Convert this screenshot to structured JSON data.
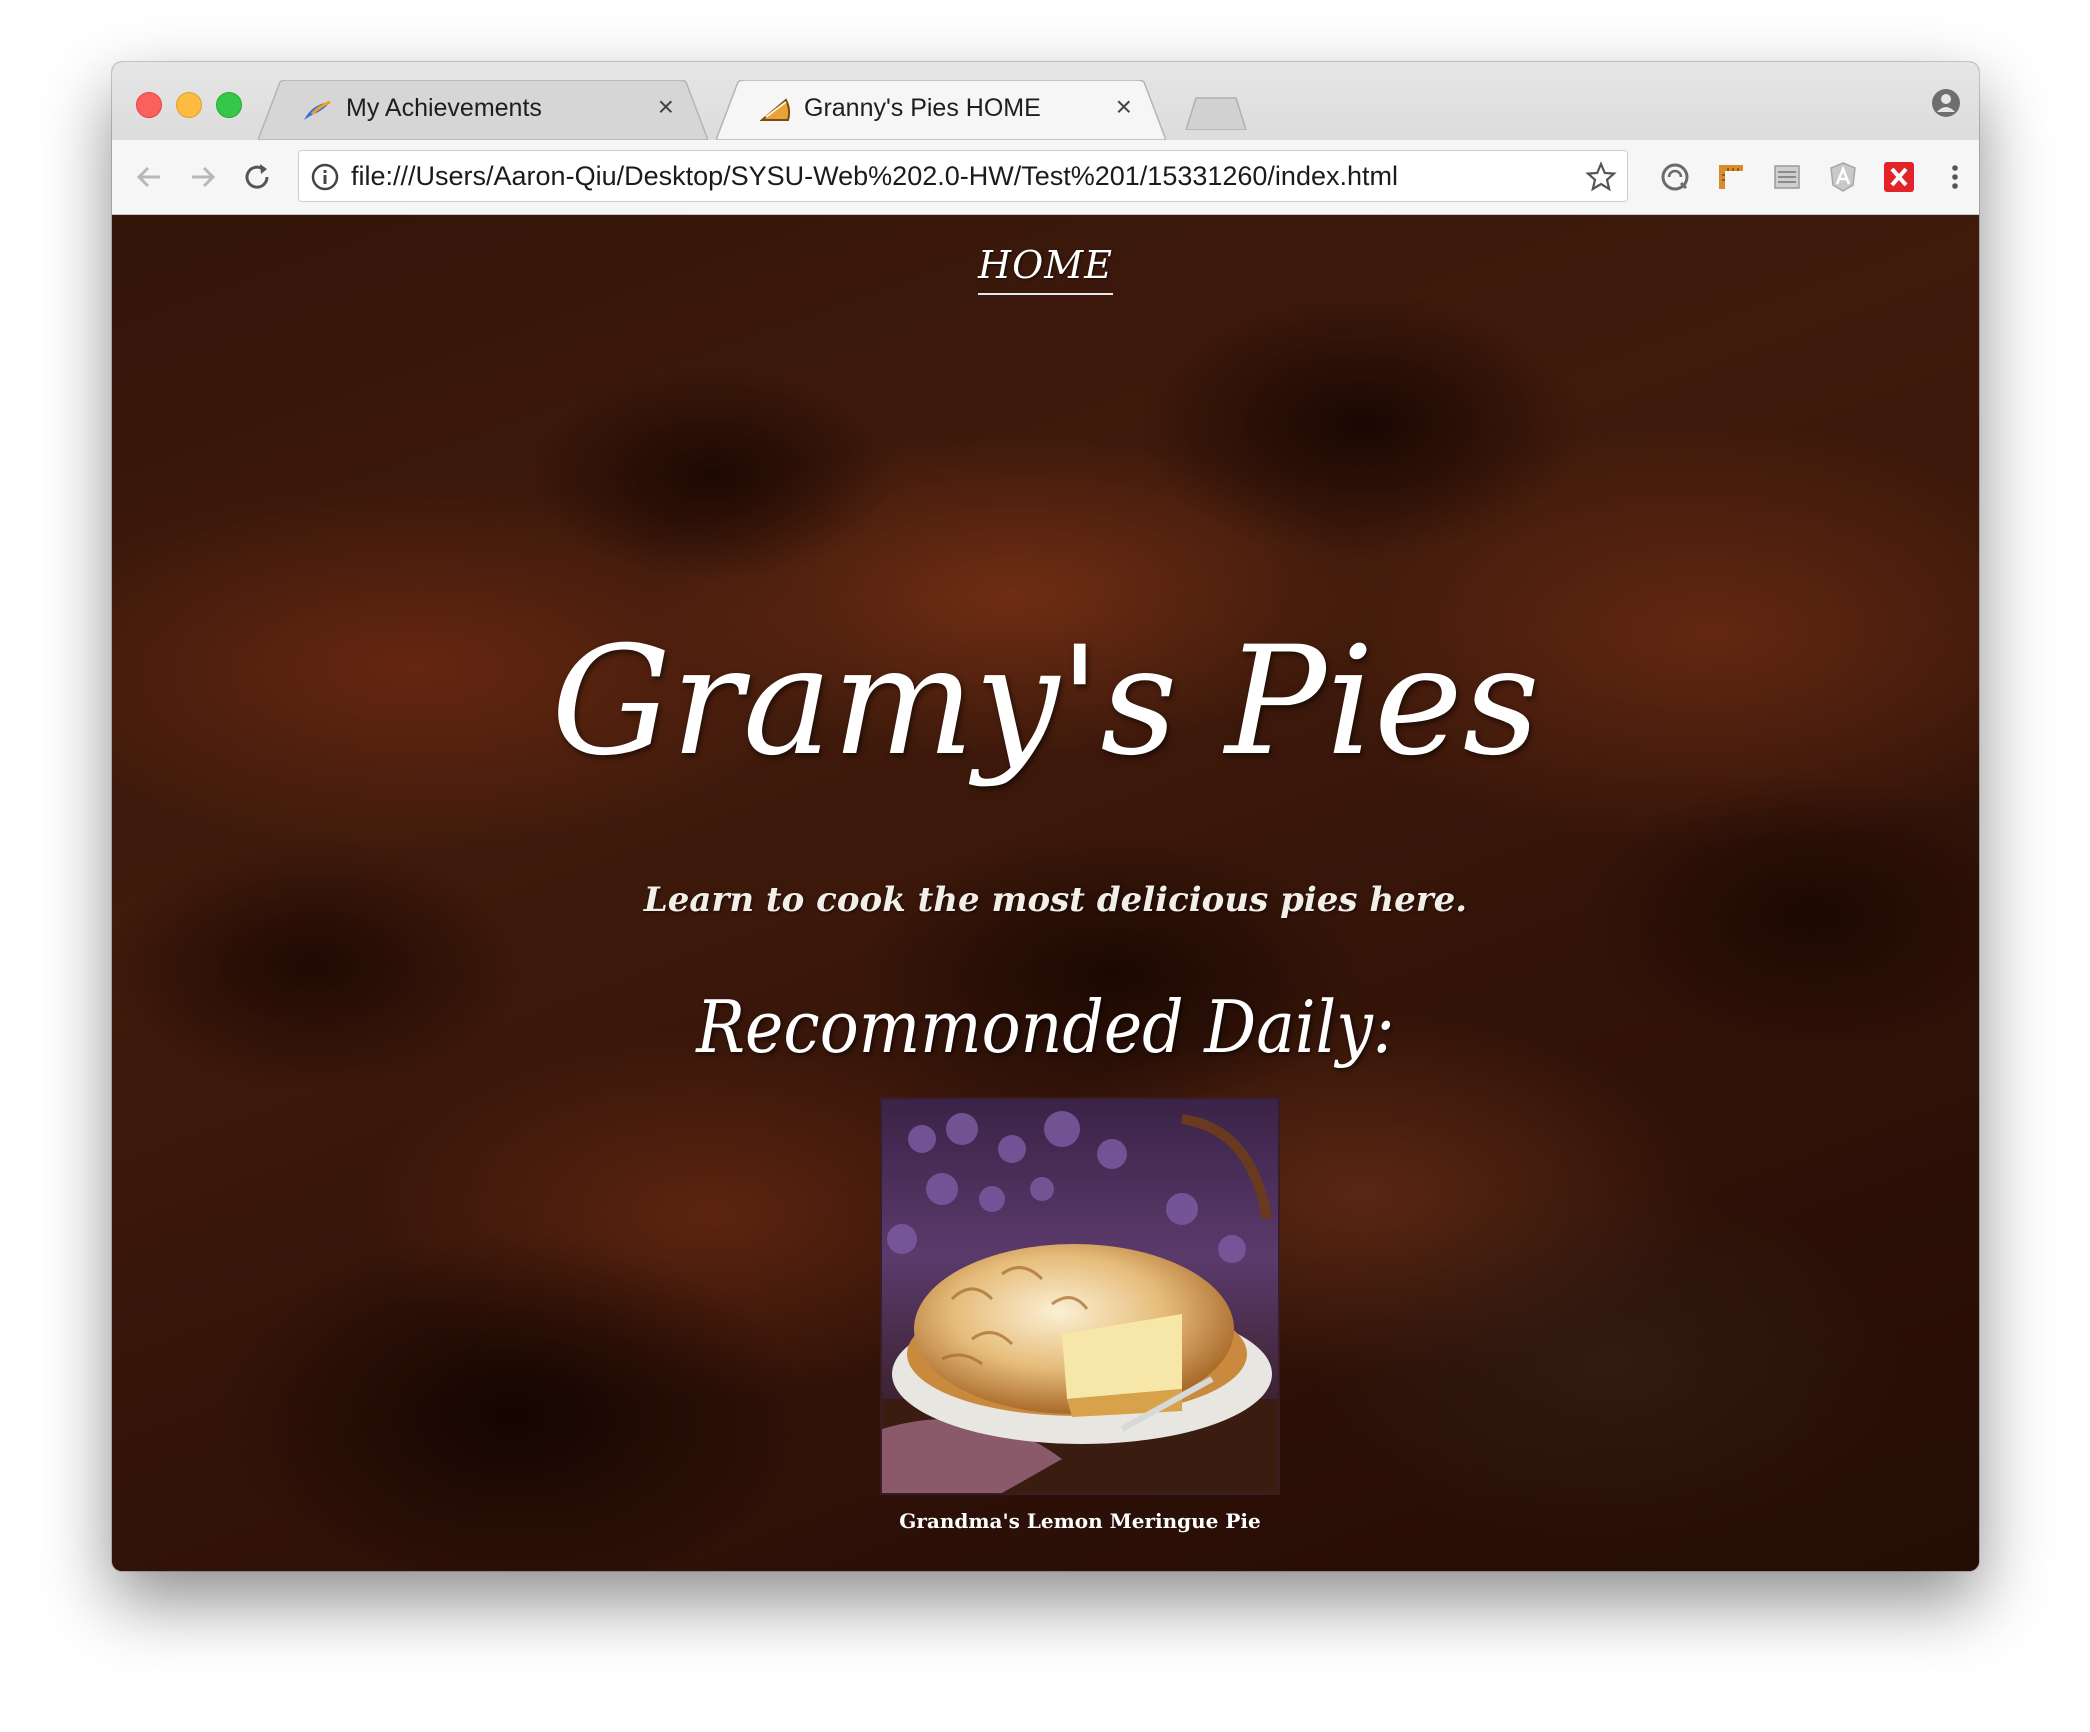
{
  "browser": {
    "tabs": [
      {
        "title": "My Achievements",
        "favicon": "feather-icon",
        "close": "×",
        "active": false
      },
      {
        "title": "Granny's Pies HOME",
        "favicon": "pie-slice-icon",
        "close": "×",
        "active": true
      }
    ],
    "url": "file:///Users/Aaron-Qiu/Desktop/SYSU-Web%202.0-HW/Test%201/15331260/index.html",
    "toolbar_icons": [
      "back-arrow-icon",
      "forward-arrow-icon",
      "reload-icon",
      "info-icon",
      "bookmark-star-icon",
      "sync-icon",
      "ruler-extension-icon",
      "list-extension-icon",
      "angular-extension-icon",
      "x-extension-icon",
      "menu-dots-icon"
    ],
    "colors": {
      "close_red": "#fc605c",
      "minimize_yellow": "#fdbc40",
      "zoom_green": "#34c84a",
      "ext_red": "#e0242a"
    }
  },
  "page": {
    "nav": {
      "home": "HOME"
    },
    "title": "Gramy's Pies",
    "tagline": "Learn to cook the most delicious pies here.",
    "recommended_heading": "Recommonded Daily:",
    "featured": {
      "caption": "Grandma's Lemon Meringue Pie",
      "image": "lemon-meringue-pie-photo"
    }
  }
}
